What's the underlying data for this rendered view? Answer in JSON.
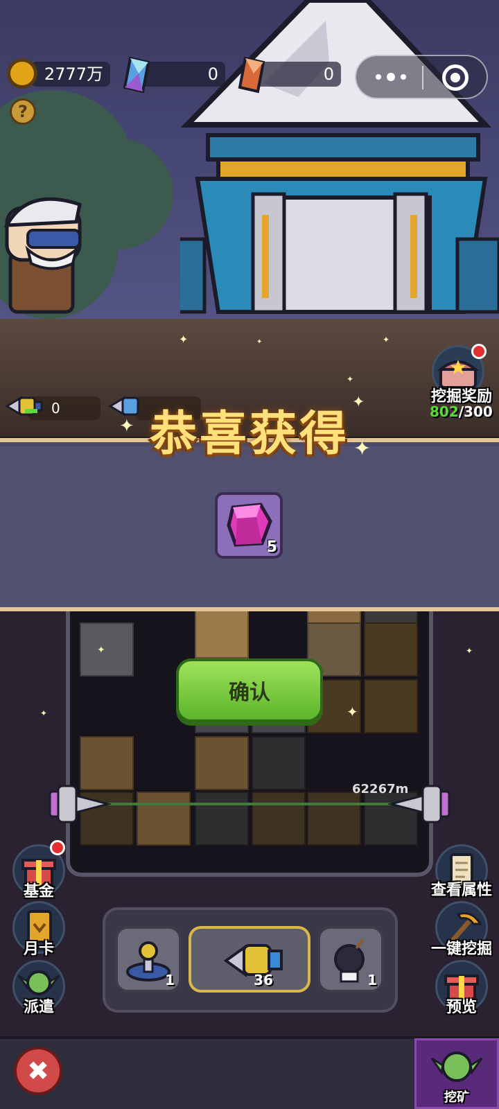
{
  "hud": {
    "gold": "2777万",
    "crystal_blue": "0",
    "crystal_orange": "0",
    "help": "?"
  },
  "dig_reward": {
    "label": "挖掘奖励",
    "progress": "802",
    "total": "/300"
  },
  "drills": [
    {
      "count": "0"
    }
  ],
  "reward_popup": {
    "title": "恭喜获得",
    "item_icon": "pink-gem-icon",
    "item_count": "5",
    "confirm_label": "确认"
  },
  "depth": "62267m",
  "left_menu": {
    "fund": "基金",
    "month_card": "月卡",
    "dispatch": "派遣"
  },
  "right_menu": {
    "view_attributes": "查看属性",
    "one_click_dig": "一键挖掘",
    "preview": "预览"
  },
  "tools": [
    {
      "icon": "radar-icon",
      "count": "1"
    },
    {
      "icon": "drill-icon",
      "count": "36"
    },
    {
      "icon": "bomb-icon",
      "count": "1"
    }
  ],
  "bottom": {
    "close": "✖",
    "mine_tab": "挖矿"
  },
  "colors": {
    "accent_gold": "#ffe07a",
    "confirm_green": "#7acc3e",
    "banner_border": "#e3c79a",
    "progress_green": "#5adb3a"
  }
}
